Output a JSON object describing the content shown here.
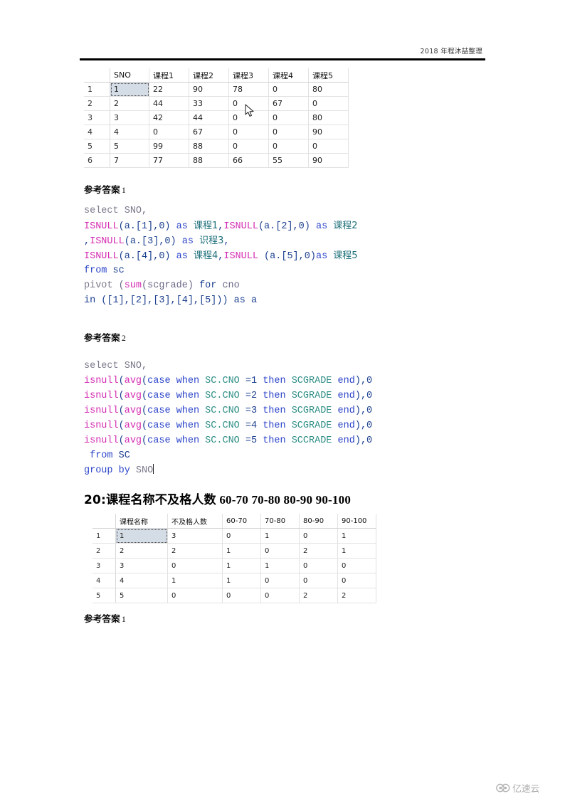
{
  "header": {
    "text": "2018 年程沐喆整理"
  },
  "pivot_table": {
    "columns": [
      "SNO",
      "课程1",
      "课程2",
      "课程3",
      "课程4",
      "课程5"
    ],
    "rows": [
      {
        "index": "1",
        "cells": [
          "1",
          "22",
          "90",
          "78",
          "0",
          "80"
        ]
      },
      {
        "index": "2",
        "cells": [
          "2",
          "44",
          "33",
          "0",
          "67",
          "0"
        ]
      },
      {
        "index": "3",
        "cells": [
          "3",
          "42",
          "44",
          "0",
          "0",
          "80"
        ]
      },
      {
        "index": "4",
        "cells": [
          "4",
          "0",
          "67",
          "0",
          "0",
          "90"
        ]
      },
      {
        "index": "5",
        "cells": [
          "5",
          "99",
          "88",
          "0",
          "0",
          "0"
        ]
      },
      {
        "index": "6",
        "cells": [
          "7",
          "77",
          "88",
          "66",
          "55",
          "90"
        ]
      }
    ],
    "selected": {
      "row": 0,
      "col": 0
    }
  },
  "answer1": {
    "label": "参考答案",
    "number": "1",
    "code_lines": [
      [
        {
          "t": "select",
          "c": "k-gray"
        },
        {
          "t": " ",
          "c": "k-plain"
        },
        {
          "t": "SNO",
          "c": "k-gray"
        },
        {
          "t": ",",
          "c": "k-plain"
        }
      ],
      [
        {
          "t": "ISNULL",
          "c": "k-pink"
        },
        {
          "t": "(a.[1],0)",
          "c": "k-dark"
        },
        {
          "t": " ",
          "c": "k-plain"
        },
        {
          "t": "as",
          "c": "k-blue"
        },
        {
          "t": " ",
          "c": "k-plain"
        },
        {
          "t": "课程1",
          "c": "k-cn"
        },
        {
          "t": ",",
          "c": "k-dark"
        },
        {
          "t": "ISNULL",
          "c": "k-pink"
        },
        {
          "t": "(a.[2],0)",
          "c": "k-dark"
        },
        {
          "t": " ",
          "c": "k-plain"
        },
        {
          "t": "as",
          "c": "k-blue"
        },
        {
          "t": " ",
          "c": "k-plain"
        },
        {
          "t": "课程2",
          "c": "k-cn"
        }
      ],
      [
        {
          "t": ",",
          "c": "k-dark"
        },
        {
          "t": "ISNULL",
          "c": "k-pink"
        },
        {
          "t": "(a.[3],0)",
          "c": "k-dark"
        },
        {
          "t": " ",
          "c": "k-plain"
        },
        {
          "t": "as",
          "c": "k-blue"
        },
        {
          "t": " ",
          "c": "k-plain"
        },
        {
          "t": "识程3",
          "c": "k-cn"
        },
        {
          "t": ",",
          "c": "k-dark"
        }
      ],
      [
        {
          "t": "ISNULL",
          "c": "k-pink"
        },
        {
          "t": "(a.[4],0)",
          "c": "k-dark"
        },
        {
          "t": " ",
          "c": "k-plain"
        },
        {
          "t": "as",
          "c": "k-blue"
        },
        {
          "t": " ",
          "c": "k-plain"
        },
        {
          "t": "课程4",
          "c": "k-cn"
        },
        {
          "t": ",",
          "c": "k-dark"
        },
        {
          "t": "ISNULL",
          "c": "k-pink"
        },
        {
          "t": " (a.[5],0)",
          "c": "k-dark"
        },
        {
          "t": "as",
          "c": "k-blue"
        },
        {
          "t": " ",
          "c": "k-plain"
        },
        {
          "t": "课程5",
          "c": "k-cn"
        }
      ],
      [
        {
          "t": "from",
          "c": "k-blue"
        },
        {
          "t": " ",
          "c": "k-plain"
        },
        {
          "t": "sc",
          "c": "k-dark"
        }
      ],
      [
        {
          "t": "pivot",
          "c": "k-gray"
        },
        {
          "t": " (",
          "c": "k-plain"
        },
        {
          "t": "sum",
          "c": "k-pink"
        },
        {
          "t": "(scgrade) ",
          "c": "k-plain"
        },
        {
          "t": "for",
          "c": "k-dark"
        },
        {
          "t": " cno",
          "c": "k-plain"
        }
      ],
      [
        {
          "t": "in ([1],[2],[3],[4],[5])) ",
          "c": "k-dark"
        },
        {
          "t": "as",
          "c": "k-dark"
        },
        {
          "t": " a",
          "c": "k-dark"
        }
      ]
    ]
  },
  "answer2": {
    "label": "参考答案",
    "number": "2",
    "code_lines": [
      [
        {
          "t": "select",
          "c": "k-gray"
        },
        {
          "t": " ",
          "c": "k-plain"
        },
        {
          "t": "SNO",
          "c": "k-gray"
        },
        {
          "t": ",",
          "c": "k-plain"
        }
      ],
      [
        {
          "t": "isnull",
          "c": "k-pink"
        },
        {
          "t": "(",
          "c": "k-dark"
        },
        {
          "t": "avg",
          "c": "k-pink"
        },
        {
          "t": "(",
          "c": "k-dark"
        },
        {
          "t": "case when",
          "c": "k-blue"
        },
        {
          "t": " ",
          "c": "k-plain"
        },
        {
          "t": "SC.CNO",
          "c": "k-teal"
        },
        {
          "t": " =1 ",
          "c": "k-dark"
        },
        {
          "t": "then",
          "c": "k-blue"
        },
        {
          "t": " ",
          "c": "k-plain"
        },
        {
          "t": "SCGRADE",
          "c": "k-teal"
        },
        {
          "t": " ",
          "c": "k-plain"
        },
        {
          "t": "end",
          "c": "k-blue"
        },
        {
          "t": "),0",
          "c": "k-dark"
        }
      ],
      [
        {
          "t": "isnull",
          "c": "k-pink"
        },
        {
          "t": "(",
          "c": "k-dark"
        },
        {
          "t": "avg",
          "c": "k-pink"
        },
        {
          "t": "(",
          "c": "k-dark"
        },
        {
          "t": "case when",
          "c": "k-blue"
        },
        {
          "t": " ",
          "c": "k-plain"
        },
        {
          "t": "SC.CNO",
          "c": "k-teal"
        },
        {
          "t": " =2 ",
          "c": "k-dark"
        },
        {
          "t": "then",
          "c": "k-blue"
        },
        {
          "t": " ",
          "c": "k-plain"
        },
        {
          "t": "SCGRADE",
          "c": "k-teal"
        },
        {
          "t": " ",
          "c": "k-plain"
        },
        {
          "t": "end",
          "c": "k-blue"
        },
        {
          "t": "),0",
          "c": "k-dark"
        }
      ],
      [
        {
          "t": "isnull",
          "c": "k-pink"
        },
        {
          "t": "(",
          "c": "k-dark"
        },
        {
          "t": "avg",
          "c": "k-pink"
        },
        {
          "t": "(",
          "c": "k-dark"
        },
        {
          "t": "case when",
          "c": "k-blue"
        },
        {
          "t": " ",
          "c": "k-plain"
        },
        {
          "t": "SC.CNO",
          "c": "k-teal"
        },
        {
          "t": " =3 ",
          "c": "k-dark"
        },
        {
          "t": "then",
          "c": "k-blue"
        },
        {
          "t": " ",
          "c": "k-plain"
        },
        {
          "t": "SCGRADE",
          "c": "k-teal"
        },
        {
          "t": " ",
          "c": "k-plain"
        },
        {
          "t": "end",
          "c": "k-blue"
        },
        {
          "t": "),0",
          "c": "k-dark"
        }
      ],
      [
        {
          "t": "isnull",
          "c": "k-pink"
        },
        {
          "t": "(",
          "c": "k-dark"
        },
        {
          "t": "avg",
          "c": "k-pink"
        },
        {
          "t": "(",
          "c": "k-dark"
        },
        {
          "t": "case when",
          "c": "k-blue"
        },
        {
          "t": " ",
          "c": "k-plain"
        },
        {
          "t": "SC.CNO",
          "c": "k-teal"
        },
        {
          "t": " =4 ",
          "c": "k-dark"
        },
        {
          "t": "then",
          "c": "k-blue"
        },
        {
          "t": " ",
          "c": "k-plain"
        },
        {
          "t": "SCGRADE",
          "c": "k-teal"
        },
        {
          "t": " ",
          "c": "k-plain"
        },
        {
          "t": "end",
          "c": "k-blue"
        },
        {
          "t": "),0",
          "c": "k-dark"
        }
      ],
      [
        {
          "t": "isnull",
          "c": "k-pink"
        },
        {
          "t": "(",
          "c": "k-dark"
        },
        {
          "t": "avg",
          "c": "k-pink"
        },
        {
          "t": "(",
          "c": "k-dark"
        },
        {
          "t": "case when",
          "c": "k-blue"
        },
        {
          "t": " ",
          "c": "k-plain"
        },
        {
          "t": "SC.CNO",
          "c": "k-teal"
        },
        {
          "t": " =5 ",
          "c": "k-dark"
        },
        {
          "t": "then",
          "c": "k-blue"
        },
        {
          "t": " ",
          "c": "k-plain"
        },
        {
          "t": "SCCRADE",
          "c": "k-teal"
        },
        {
          "t": " ",
          "c": "k-plain"
        },
        {
          "t": "end",
          "c": "k-blue"
        },
        {
          "t": "),0",
          "c": "k-dark"
        }
      ],
      [
        {
          "t": " ",
          "c": "k-plain"
        },
        {
          "t": "from",
          "c": "k-blue"
        },
        {
          "t": " ",
          "c": "k-plain"
        },
        {
          "t": "SC",
          "c": "k-dark"
        }
      ],
      [
        {
          "t": "group by",
          "c": "k-blue"
        },
        {
          "t": " ",
          "c": "k-plain"
        },
        {
          "t": "SNO",
          "c": "k-gray"
        }
      ]
    ]
  },
  "section20": {
    "prefix": "20:",
    "title": "课程名称不及格人数",
    "ranges": "60-70  70-80  80-90  90-100"
  },
  "fail_table": {
    "columns": [
      "课程名称",
      "不及格人数",
      "60-70",
      "70-80",
      "80-90",
      "90-100"
    ],
    "rows": [
      {
        "index": "1",
        "cells": [
          "1",
          "3",
          "0",
          "1",
          "0",
          "1"
        ]
      },
      {
        "index": "2",
        "cells": [
          "2",
          "2",
          "1",
          "0",
          "2",
          "1"
        ]
      },
      {
        "index": "3",
        "cells": [
          "3",
          "0",
          "1",
          "1",
          "0",
          "0"
        ]
      },
      {
        "index": "4",
        "cells": [
          "4",
          "1",
          "1",
          "0",
          "0",
          "0"
        ]
      },
      {
        "index": "5",
        "cells": [
          "5",
          "0",
          "0",
          "0",
          "2",
          "2"
        ]
      }
    ],
    "selected": {
      "row": 0,
      "col": 0
    }
  },
  "answer3": {
    "label": "参考答案",
    "number": "1"
  },
  "watermark": {
    "text": "亿速云"
  },
  "colors": {
    "keyword_blue": "#2b44c9",
    "function_pink": "#d42bb2",
    "identifier_teal": "#2f8f86",
    "grid_border": "#e2e2e2",
    "selection": "#d4dce6"
  }
}
